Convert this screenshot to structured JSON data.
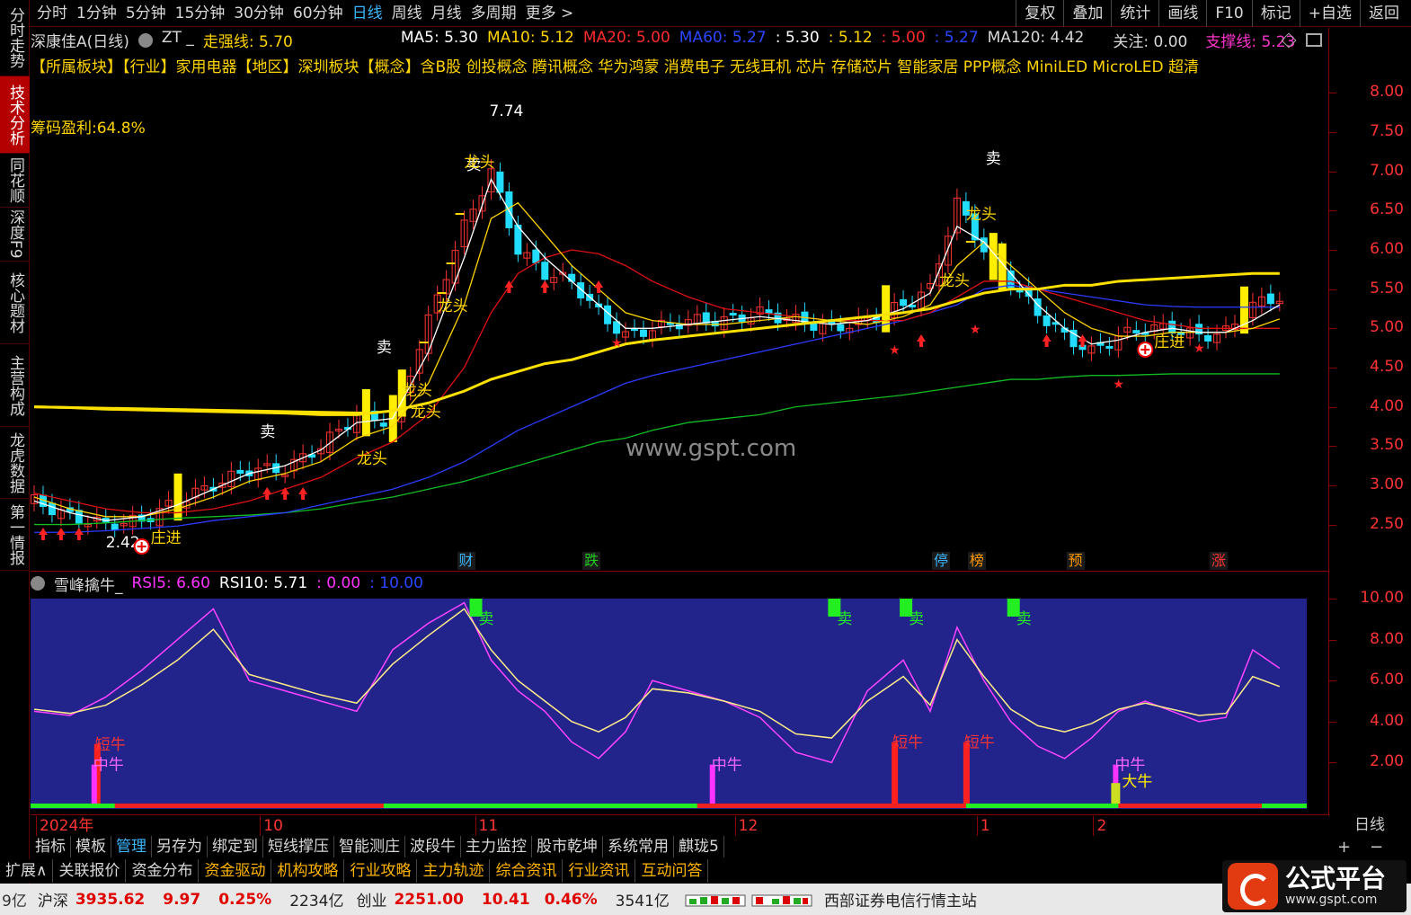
{
  "periods": [
    "分时",
    "1分钟",
    "5分钟",
    "15分钟",
    "30分钟",
    "60分钟",
    "日线",
    "周线",
    "月线",
    "多周期",
    "更多 >"
  ],
  "active_period": "日线",
  "top_actions": [
    "复权",
    "叠加",
    "统计",
    "画线",
    "F10",
    "标记",
    "+自选",
    "返回"
  ],
  "left_tabs": [
    "分时走势",
    "技术分析",
    "同花顺",
    "深度F9",
    "核心题材",
    "主营构成",
    "龙虎数据",
    "第一情报"
  ],
  "header": {
    "stock": "深康佳A(日线)",
    "zt": "ZT _",
    "strong_line": "走强线: 5.70",
    "ma5": "MA5: 5.30",
    "ma10": "MA10: 5.12",
    "ma20": "MA20: 5.00",
    "ma60": "MA60: 5.27",
    "v1": ": 5.30",
    "v2": ": 5.12",
    "v3": ": 5.00",
    "v4": ": 5.27",
    "ma120": "MA120: 4.42",
    "focus": "关注: 0.00",
    "support": "支撑线: 5.23"
  },
  "concepts": "【所属板块】【行业】家用电器【地区】深圳板块【概念】含B股 创投概念 腾讯概念 华为鸿蒙 消费电子 无线耳机 芯片 存储芯片 智能家居 PPP概念 MiniLED MicroLED 超清",
  "chip_profit": "筹码盈利:64.8%",
  "watermark": "www.gspt.com",
  "sub_indicator": {
    "name": "雪峰擒牛_",
    "rsi5": "RSI5: 6.60",
    "rsi10": "RSI10: 5.71",
    "v1": ": 0.00",
    "v2": ": 10.00"
  },
  "price_axis": [
    "8.00",
    "7.50",
    "7.00",
    "6.50",
    "6.00",
    "5.50",
    "5.00",
    "4.50",
    "4.00",
    "3.50",
    "3.00",
    "2.50"
  ],
  "sub_axis": [
    "10.00",
    "8.00",
    "6.00",
    "4.00",
    "2.00"
  ],
  "date_axis": [
    "2024年",
    "10",
    "11",
    "12",
    "1",
    "2"
  ],
  "daily": "日线",
  "toolbar1": [
    "指标",
    "模板",
    "管理",
    "另存为",
    "绑定到",
    "短线撑压",
    "智能测庄",
    "波段牛",
    "主力监控",
    "股市乾坤",
    "系统常用",
    "麒珑5"
  ],
  "toolbar1_active": "管理",
  "toolbar2": [
    {
      "label": "扩展∧",
      "color": "#d8d8d8"
    },
    {
      "label": "关联报价",
      "color": "#d8d8d8"
    },
    {
      "label": "资金分布",
      "color": "#d8d8d8"
    },
    {
      "label": "资金驱动",
      "color": "#ffb400"
    },
    {
      "label": "机构攻略",
      "color": "#ffb400"
    },
    {
      "label": "行业攻略",
      "color": "#ffb400"
    },
    {
      "label": "主力轨迹",
      "color": "#ffb400"
    },
    {
      "label": "综合资讯",
      "color": "#ffb400"
    },
    {
      "label": "行业资讯",
      "color": "#ffb400"
    },
    {
      "label": "互动问答",
      "color": "#ffb400"
    }
  ],
  "plus": "+",
  "minus": "−",
  "status": {
    "prefix": "9亿",
    "sh_label": "沪深",
    "sh_value": "3935.62",
    "sh_change": "9.97",
    "sh_pct": "0.25%",
    "sh_amount": "2234亿",
    "cy_label": "创业",
    "cy_value": "2251.00",
    "cy_change": "10.41",
    "cy_pct": "0.46%",
    "cy_amount": "3541亿",
    "server": "西部证券电信行情主站"
  },
  "logo": {
    "title": "公式平台",
    "url": "www.gspt.com"
  },
  "annotations": {
    "sell": "卖",
    "dragon": "龙头",
    "zhuang": "庄进",
    "peak": "7.74",
    "low": "2.42",
    "short_bull": "短牛",
    "mid_bull": "中牛",
    "big_bull": "大牛"
  },
  "events": [
    {
      "label": "财",
      "color": "#3ab7ff",
      "day": 49
    },
    {
      "label": "跌",
      "color": "#22cc22",
      "day": 63
    },
    {
      "label": "停",
      "color": "#3ab7ff",
      "day": 102
    },
    {
      "label": "榜",
      "color": "#ff9900",
      "day": 106
    },
    {
      "label": "预",
      "color": "#ff9900",
      "day": 117
    },
    {
      "label": "涨",
      "color": "#ff3333",
      "day": 133
    }
  ],
  "chart_data": {
    "type": "line",
    "xlabel": "",
    "ylabel": "",
    "ylim": [
      2.3,
      8.2
    ],
    "x": [
      1,
      5,
      9,
      13,
      17,
      21,
      25,
      29,
      33,
      37,
      41,
      45,
      49,
      52,
      55,
      58,
      61,
      64,
      67,
      70,
      74,
      78,
      82,
      86,
      90,
      94,
      98,
      101,
      104,
      107,
      110,
      113,
      116,
      119,
      122,
      125,
      128,
      131,
      134,
      137,
      140
    ],
    "series": [
      {
        "name": "close",
        "values": [
          2.8,
          2.6,
          2.5,
          2.55,
          2.8,
          3.0,
          3.2,
          3.2,
          3.5,
          3.9,
          3.8,
          5.1,
          6.3,
          7.0,
          6.0,
          5.7,
          5.6,
          5.2,
          4.9,
          5.0,
          5.1,
          5.1,
          5.2,
          5.1,
          5.0,
          5.1,
          5.3,
          5.5,
          6.6,
          6.0,
          5.6,
          5.2,
          4.9,
          4.7,
          4.9,
          5.0,
          5.0,
          4.9,
          4.95,
          5.3,
          5.4
        ]
      },
      {
        "name": "MA5",
        "values": [
          2.8,
          2.65,
          2.55,
          2.6,
          2.75,
          2.95,
          3.15,
          3.25,
          3.45,
          3.8,
          3.85,
          4.7,
          5.9,
          6.9,
          6.3,
          5.9,
          5.6,
          5.3,
          5.0,
          5.0,
          5.05,
          5.1,
          5.15,
          5.1,
          5.05,
          5.1,
          5.25,
          5.45,
          6.3,
          6.1,
          5.7,
          5.3,
          5.0,
          4.8,
          4.85,
          4.95,
          5.0,
          4.95,
          4.95,
          5.1,
          5.3
        ]
      },
      {
        "name": "MA10",
        "values": [
          2.85,
          2.7,
          2.6,
          2.6,
          2.7,
          2.85,
          3.05,
          3.15,
          3.3,
          3.6,
          3.75,
          4.3,
          5.3,
          6.4,
          6.6,
          6.2,
          5.8,
          5.5,
          5.2,
          5.1,
          5.05,
          5.05,
          5.1,
          5.15,
          5.1,
          5.05,
          5.15,
          5.3,
          5.8,
          6.1,
          5.8,
          5.5,
          5.2,
          5.0,
          4.9,
          4.9,
          4.95,
          4.95,
          4.95,
          5.0,
          5.12
        ]
      },
      {
        "name": "MA20",
        "values": [
          2.9,
          2.8,
          2.7,
          2.65,
          2.65,
          2.7,
          2.8,
          2.95,
          3.1,
          3.35,
          3.55,
          3.9,
          4.5,
          5.2,
          5.7,
          5.9,
          6.0,
          5.95,
          5.8,
          5.6,
          5.4,
          5.25,
          5.2,
          5.15,
          5.1,
          5.1,
          5.1,
          5.2,
          5.4,
          5.6,
          5.6,
          5.5,
          5.4,
          5.3,
          5.2,
          5.1,
          5.05,
          5.0,
          5.0,
          5.0,
          5.0
        ]
      },
      {
        "name": "MA60",
        "values": [
          2.4,
          2.4,
          2.42,
          2.45,
          2.48,
          2.55,
          2.6,
          2.65,
          2.75,
          2.85,
          2.95,
          3.1,
          3.3,
          3.5,
          3.7,
          3.85,
          4.0,
          4.15,
          4.3,
          4.4,
          4.5,
          4.6,
          4.7,
          4.8,
          4.9,
          5.0,
          5.1,
          5.2,
          5.3,
          5.5,
          5.55,
          5.5,
          5.45,
          5.4,
          5.35,
          5.3,
          5.28,
          5.27,
          5.27,
          5.27,
          5.27
        ]
      },
      {
        "name": "MA120",
        "values": [
          2.5,
          2.5,
          2.52,
          2.55,
          2.58,
          2.6,
          2.62,
          2.65,
          2.7,
          2.78,
          2.85,
          2.95,
          3.05,
          3.15,
          3.25,
          3.35,
          3.45,
          3.55,
          3.6,
          3.7,
          3.8,
          3.85,
          3.9,
          4.0,
          4.05,
          4.1,
          4.15,
          4.2,
          4.25,
          4.3,
          4.35,
          4.35,
          4.38,
          4.4,
          4.4,
          4.41,
          4.42,
          4.42,
          4.42,
          4.42,
          4.42
        ]
      },
      {
        "name": "走强线",
        "values": [
          4.0,
          3.99,
          3.97,
          3.96,
          3.95,
          3.94,
          3.93,
          3.92,
          3.9,
          3.9,
          3.95,
          4.05,
          4.2,
          4.35,
          4.45,
          4.55,
          4.6,
          4.7,
          4.8,
          4.85,
          4.9,
          4.95,
          5.0,
          5.05,
          5.1,
          5.15,
          5.2,
          5.25,
          5.35,
          5.45,
          5.5,
          5.5,
          5.55,
          5.55,
          5.6,
          5.62,
          5.64,
          5.66,
          5.68,
          5.7,
          5.7
        ]
      },
      {
        "name": "RSI5",
        "values": [
          4.5,
          4.3,
          5.2,
          6.5,
          8.0,
          9.5,
          6.0,
          5.5,
          5.0,
          4.5,
          7.5,
          8.8,
          9.8,
          7.0,
          5.5,
          4.5,
          3.0,
          2.2,
          3.5,
          6.0,
          5.5,
          5.0,
          4.2,
          2.5,
          2.0,
          5.5,
          7.0,
          4.5,
          8.6,
          6.0,
          4.0,
          2.8,
          2.2,
          3.2,
          4.5,
          5.0,
          4.5,
          4.0,
          4.2,
          7.5,
          6.6
        ]
      },
      {
        "name": "RSI10",
        "values": [
          4.6,
          4.4,
          4.8,
          5.8,
          7.0,
          8.5,
          6.3,
          5.8,
          5.3,
          4.9,
          6.8,
          8.2,
          9.5,
          7.5,
          6.0,
          5.0,
          4.0,
          3.5,
          4.2,
          5.6,
          5.4,
          5.0,
          4.5,
          3.4,
          3.2,
          5.0,
          6.2,
          4.8,
          8.0,
          6.2,
          4.6,
          3.8,
          3.5,
          3.9,
          4.6,
          4.9,
          4.6,
          4.3,
          4.4,
          6.2,
          5.71
        ]
      }
    ]
  }
}
